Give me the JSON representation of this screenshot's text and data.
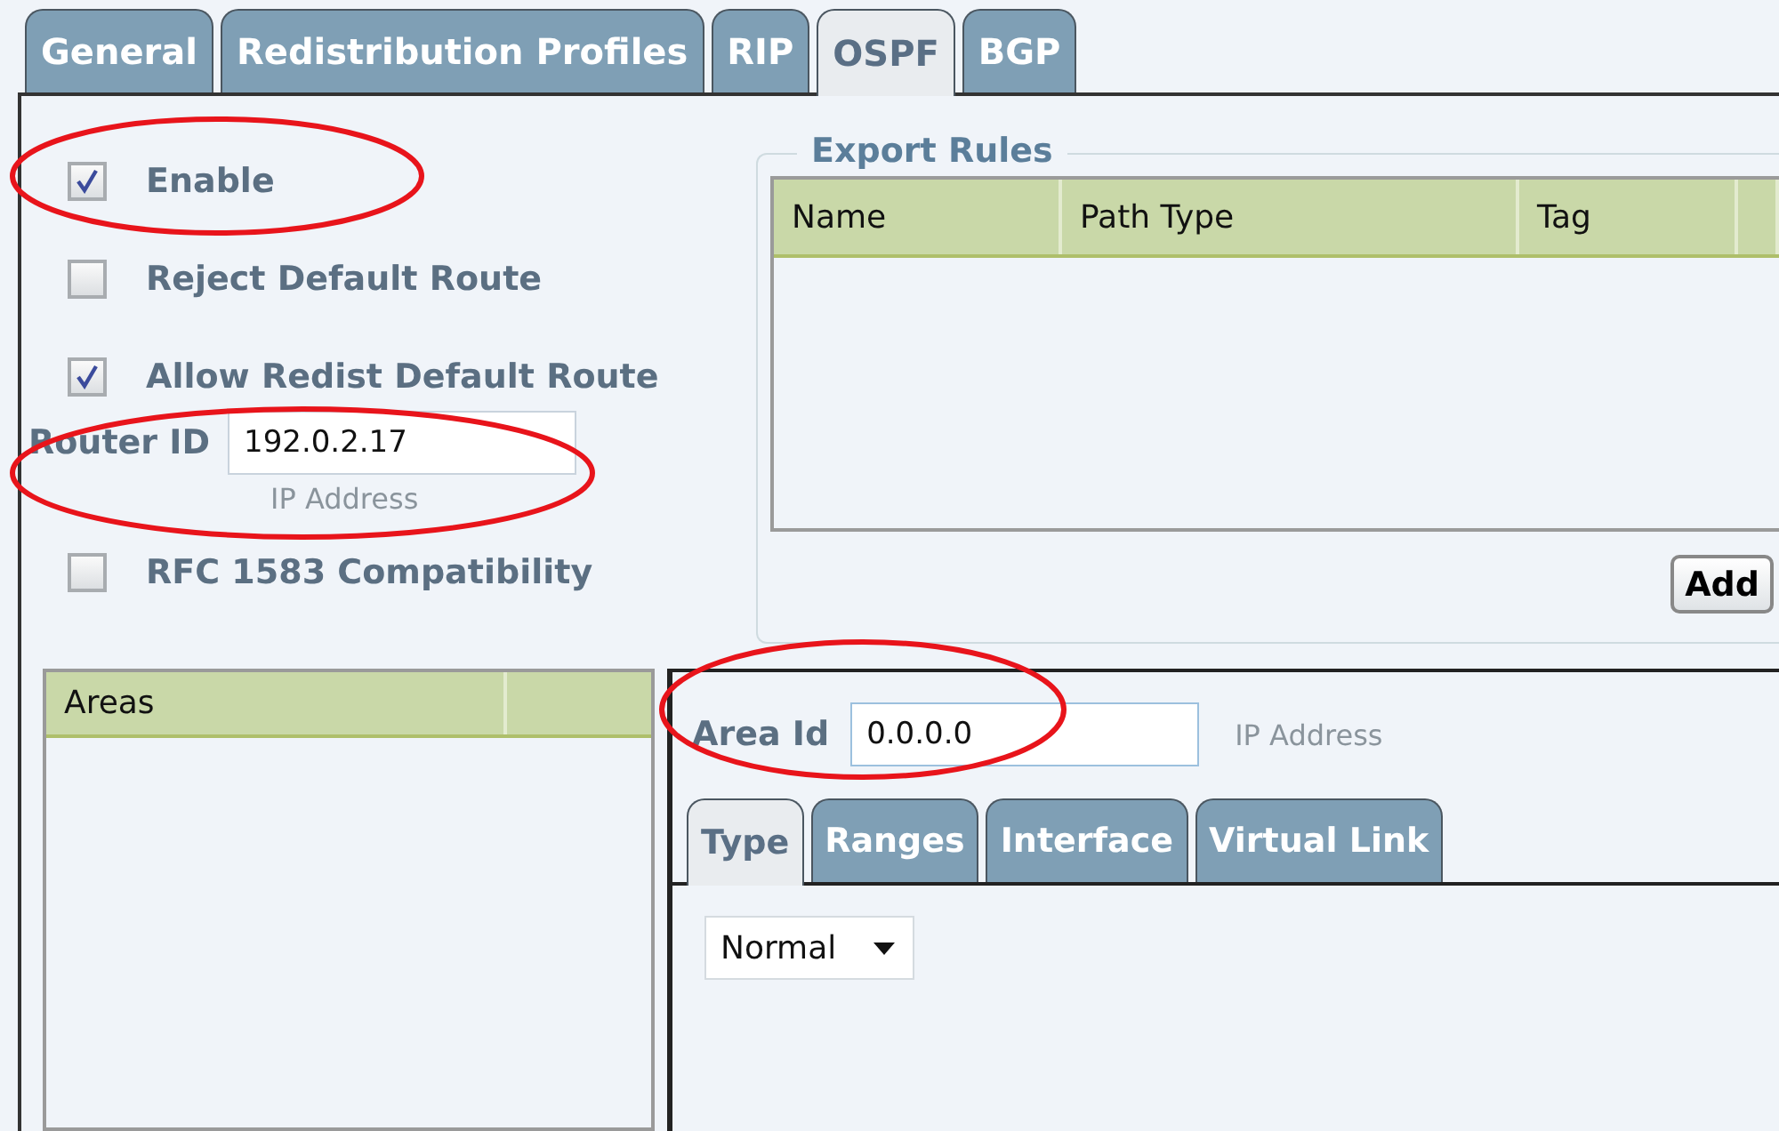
{
  "tabs": [
    {
      "label": "General",
      "selected": false
    },
    {
      "label": "Redistribution Profiles",
      "selected": false
    },
    {
      "label": "RIP",
      "selected": false
    },
    {
      "label": "OSPF",
      "selected": true
    },
    {
      "label": "BGP",
      "selected": false
    }
  ],
  "options": [
    {
      "label": "Enable",
      "checked": true
    },
    {
      "label": "Reject Default Route",
      "checked": false
    },
    {
      "label": "Allow Redist Default Route",
      "checked": true
    }
  ],
  "router_id": {
    "label": "Router ID",
    "value": "192.0.2.17",
    "hint": "IP Address"
  },
  "rfc_option": {
    "label": "RFC 1583 Compatibility",
    "checked": false
  },
  "export_rules": {
    "title": "Export Rules",
    "columns": [
      "Name",
      "Path Type",
      "Tag"
    ],
    "add_button": "Add"
  },
  "areas": {
    "columns": [
      "Areas"
    ]
  },
  "area_id": {
    "label": "Area Id",
    "value": "0.0.0.0",
    "hint": "IP Address"
  },
  "area_tabs": [
    {
      "label": "Type",
      "selected": true
    },
    {
      "label": "Ranges",
      "selected": false
    },
    {
      "label": "Interface",
      "selected": false
    },
    {
      "label": "Virtual Link",
      "selected": false
    }
  ],
  "area_type": {
    "value": "Normal"
  }
}
